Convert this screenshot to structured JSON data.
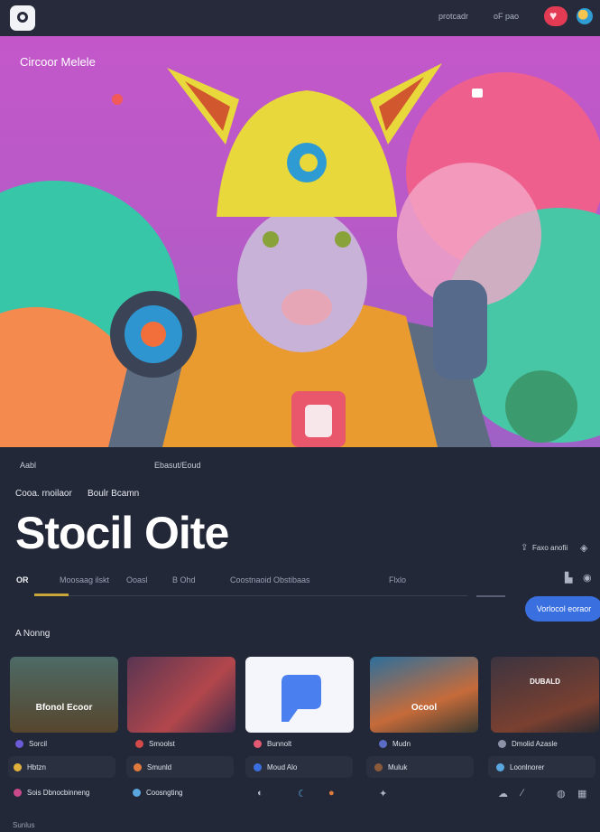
{
  "topbar": {
    "link_1": "protcadr",
    "link_2": "oF pao",
    "heart_icon": "heart-icon"
  },
  "hero": {
    "title": "Circoor Melele"
  },
  "meta": {
    "left": "Aabl",
    "center": "Ebasut/Eoud"
  },
  "subtitle": {
    "left": "Cooa. rnoilaor",
    "right": "Boulr Bcamn"
  },
  "page": {
    "title": "Stocil Oite"
  },
  "right_meta": {
    "label": "Faxo  anofii"
  },
  "tabs": [
    {
      "label": "OR"
    },
    {
      "label": "Moosaag ilskt"
    },
    {
      "label": "Ooasl"
    },
    {
      "label": "B Ohd"
    },
    {
      "label": "Coostnaoid Obstibaas"
    },
    {
      "label": "Flxlo"
    }
  ],
  "follow_button": {
    "label": "Vorlocol eoraor"
  },
  "section": {
    "title": "A Nonng"
  },
  "cards": [
    {
      "caption": "Bfonol Ecoor",
      "name": "Sorcil",
      "sub": "Hbtzn"
    },
    {
      "caption": "",
      "name": "Smoolst",
      "sub": "Smunld"
    },
    {
      "caption": "",
      "name": "Bunnolt",
      "sub": "Moud Alo"
    },
    {
      "caption": "Ocool",
      "name": "Mudn",
      "sub": "Muluk"
    },
    {
      "caption": "DUBALD",
      "name": "Dmolid  Azasle",
      "sub": "Loonlnorer"
    }
  ],
  "bottom_row": {
    "item_1": "Sois  Dbnocbinneng",
    "item_2": "Coosngting"
  },
  "footer": {
    "label": "Sunlus"
  },
  "colors": {
    "accent": "#3a6fe0",
    "hero_bg": "#c357c9",
    "background": "#232838",
    "tab_underline": "#c9a63a"
  }
}
